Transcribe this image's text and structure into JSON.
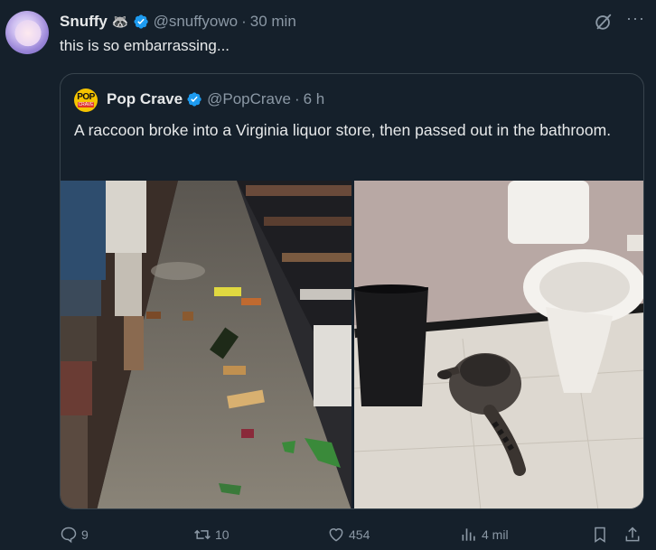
{
  "author": {
    "name": "Snuffy",
    "emoji": "🦝",
    "handle": "@snuffyowo",
    "separator": "·",
    "time": "30 min"
  },
  "text": "this is so embarrassing...",
  "quoted": {
    "avatar_text": "POP",
    "avatar_subtext": "CRAVE",
    "name": "Pop Crave",
    "handle": "@PopCrave",
    "separator": "·",
    "time": "6 h",
    "text": "A raccoon broke into a Virginia liquor store, then passed out in the bathroom."
  },
  "more_label": "···",
  "actions": {
    "replies": "9",
    "reposts": "10",
    "likes": "454",
    "views": "4 mil"
  },
  "colors": {
    "background": "#15202b",
    "verified": "#1d9bf0",
    "muted": "#8b98a5",
    "border": "#38444d"
  },
  "icons": [
    "verified-badge-icon",
    "grok-icon",
    "more-icon",
    "reply-icon",
    "repost-icon",
    "like-icon",
    "views-icon",
    "bookmark-icon",
    "share-icon"
  ]
}
